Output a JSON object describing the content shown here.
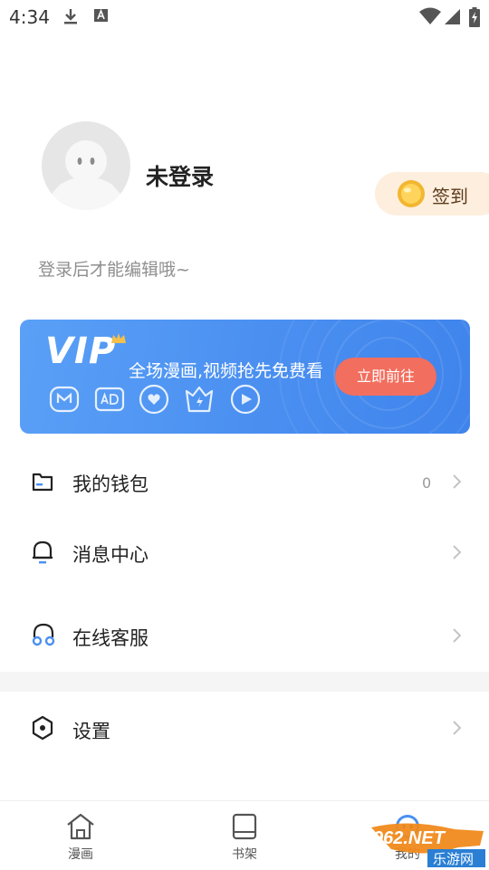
{
  "status_bar": {
    "time": "4:34",
    "left_icons": [
      "download-icon",
      "a-notification-icon"
    ],
    "right_icons": [
      "wifi-icon",
      "signal-icon",
      "battery-charging-icon"
    ]
  },
  "profile": {
    "username": "未登录",
    "hint": "登录后才能编辑哦~",
    "checkin_label": "签到"
  },
  "vip_banner": {
    "logo": "VIP",
    "slogan": "全场漫画,视频抢先免费看",
    "button_label": "立即前往",
    "perk_icons": [
      "m-badge-icon",
      "ad-free-icon",
      "heart-icon",
      "crown-badge-icon",
      "play-icon"
    ],
    "colors": {
      "background": "#4a8ff0",
      "button": "#f26e5e"
    }
  },
  "menu": [
    {
      "label": "我的钱包",
      "value": "0",
      "icon": "wallet-icon"
    },
    {
      "label": "消息中心",
      "icon": "bell-icon"
    },
    {
      "label": "在线客服",
      "icon": "headset-icon"
    },
    {
      "label": "设置",
      "icon": "settings-hexagon-icon"
    }
  ],
  "bottom_nav": {
    "items": [
      {
        "label": "漫画",
        "icon": "home-icon"
      },
      {
        "label": "书架",
        "icon": "bookshelf-icon"
      },
      {
        "label": "我的",
        "icon": "mine-icon"
      }
    ]
  },
  "watermark": {
    "text": "962.NET",
    "subtext": "乐游网"
  }
}
